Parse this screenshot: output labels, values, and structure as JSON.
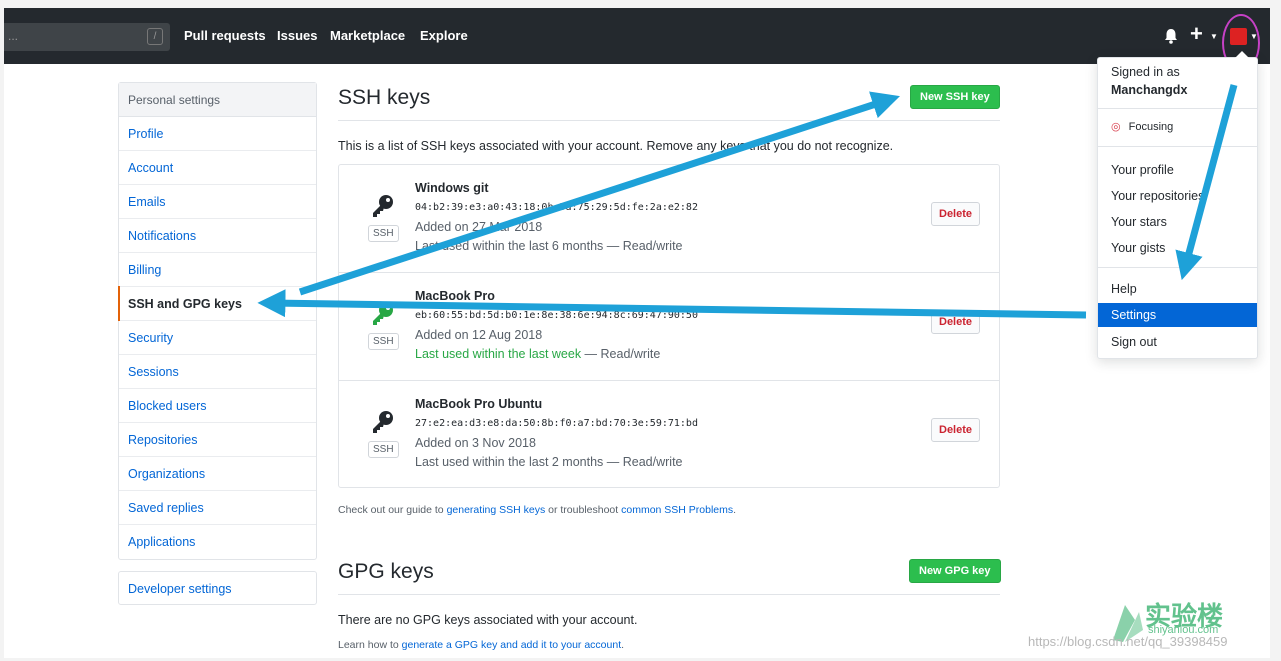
{
  "topbar": {
    "search_value": "...",
    "slash": "/",
    "nav": [
      "Pull requests",
      "Issues",
      "Marketplace",
      "Explore"
    ]
  },
  "sidebar": {
    "header": "Personal settings",
    "items": [
      "Profile",
      "Account",
      "Emails",
      "Notifications",
      "Billing",
      "SSH and GPG keys",
      "Security",
      "Sessions",
      "Blocked users",
      "Repositories",
      "Organizations",
      "Saved replies",
      "Applications"
    ],
    "developer": "Developer settings"
  },
  "ssh": {
    "title": "SSH keys",
    "new_button": "New SSH key",
    "description": "This is a list of SSH keys associated with your account. Remove any keys that you do not recognize.",
    "keys": [
      {
        "title": "Windows git",
        "fingerprint": "04:b2:39:e3:a0:43:18:0b:5a:75:29:5d:fe:2a:e2:82",
        "added": "Added on 27 Mar 2018",
        "used": "Last used within the last 6 months — Read/write",
        "used_green": "",
        "used_rest": "",
        "badge": "SSH",
        "delete": "Delete"
      },
      {
        "title": "MacBook Pro",
        "fingerprint": "eb:60:55:bd:5d:b0:1e:8e:38:6e:94:8c:69:47:90:50",
        "added": "Added on 12 Aug 2018",
        "used": "",
        "used_green": "Last used within the last week",
        "used_rest": " — Read/write",
        "badge": "SSH",
        "delete": "Delete"
      },
      {
        "title": "MacBook Pro Ubuntu",
        "fingerprint": "27:e2:ea:d3:e8:da:50:8b:f0:a7:bd:70:3e:59:71:bd",
        "added": "Added on 3 Nov 2018",
        "used": "Last used within the last 2 months — Read/write",
        "used_green": "",
        "used_rest": "",
        "badge": "SSH",
        "delete": "Delete"
      }
    ],
    "guide_pre": "Check out our guide to ",
    "guide_link1": "generating SSH keys",
    "guide_mid": " or troubleshoot ",
    "guide_link2": "common SSH Problems",
    "guide_end": "."
  },
  "gpg": {
    "title": "GPG keys",
    "new_button": "New GPG key",
    "none": "There are no GPG keys associated with your account.",
    "learn_pre": "Learn how to ",
    "learn_link": "generate a GPG key and add it to your account",
    "learn_end": "."
  },
  "menu": {
    "signed_in": "Signed in as",
    "username": "Manchangdx",
    "status": "Focusing",
    "items_a": [
      "Your profile",
      "Your repositories",
      "Your stars",
      "Your gists"
    ],
    "items_b": [
      "Help",
      "Settings",
      "Sign out"
    ]
  },
  "watermark": {
    "cn": "实验楼",
    "en": "shiyanlou.com",
    "url": "https://blog.csdn.net/qq_39398459"
  },
  "colors": {
    "accent": "#0366d6",
    "green": "#2cbe4e",
    "arrow": "#1ea1d8",
    "selected_bar": "#e36209"
  }
}
